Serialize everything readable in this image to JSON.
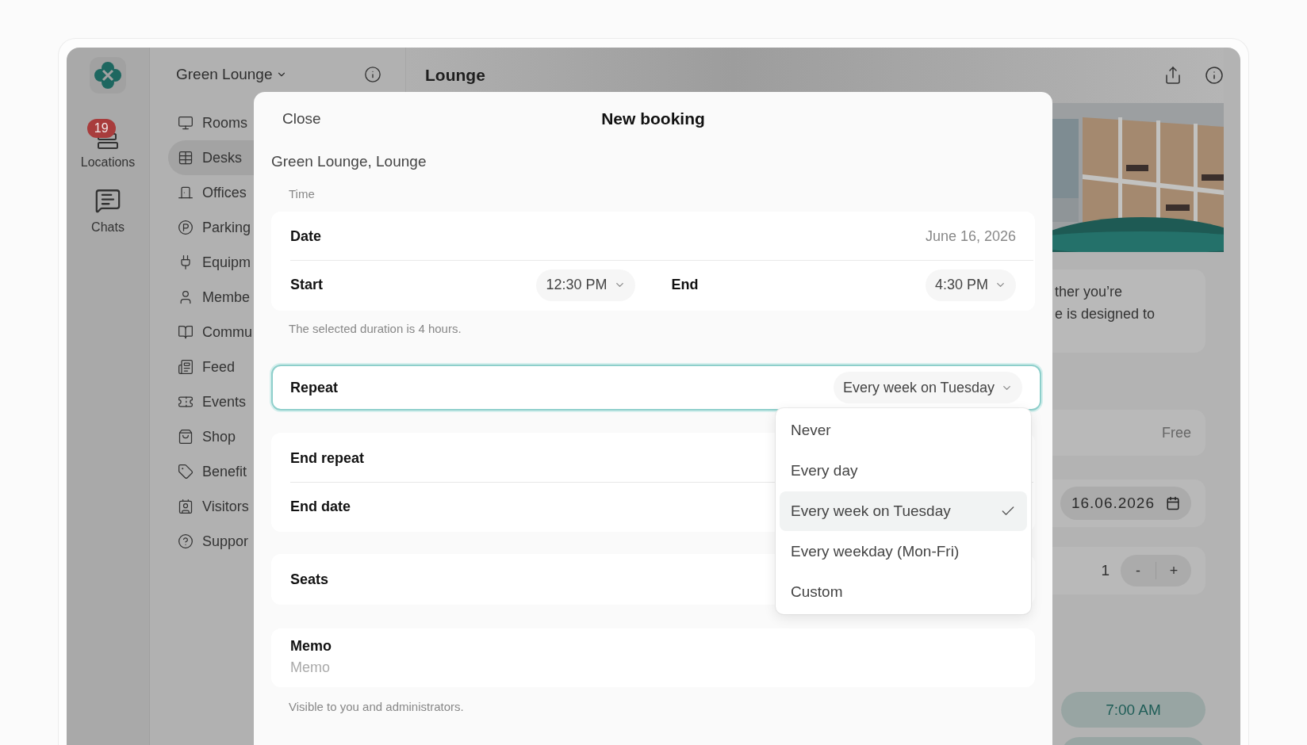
{
  "rail": {
    "items": [
      {
        "label": "Locations",
        "badge": "19"
      },
      {
        "label": "Chats"
      }
    ]
  },
  "sidebar": {
    "title": "Green Lounge",
    "items": [
      {
        "label": "Rooms",
        "selected": false
      },
      {
        "label": "Desks",
        "selected": true
      },
      {
        "label": "Offices",
        "selected": false
      },
      {
        "label": "Parking",
        "selected": false
      },
      {
        "label": "Equipm",
        "selected": false
      },
      {
        "label": "Membe",
        "selected": false
      },
      {
        "label": "Commu",
        "selected": false
      },
      {
        "label": "Feed",
        "selected": false
      },
      {
        "label": "Events",
        "selected": false
      },
      {
        "label": "Shop",
        "selected": false
      },
      {
        "label": "Benefit",
        "selected": false
      },
      {
        "label": "Visitors",
        "selected": false
      },
      {
        "label": "Suppor",
        "selected": false
      }
    ]
  },
  "main": {
    "title": "Lounge",
    "description_lines": [
      "ther you’re",
      "e is designed to"
    ],
    "price": "Free",
    "date": "16.06.2026",
    "seats": "1",
    "stepper": [
      "-",
      "+"
    ],
    "times": [
      "7:00 AM"
    ]
  },
  "modal": {
    "close": "Close",
    "title": "New booking",
    "location": "Green Lounge, Lounge",
    "time_section": "Time",
    "date": {
      "label": "Date",
      "value": "June 16, 2026"
    },
    "start": {
      "label": "Start",
      "value": "12:30 PM"
    },
    "end": {
      "label": "End",
      "value": "4:30 PM"
    },
    "duration_note": "The selected duration is 4 hours.",
    "repeat": {
      "label": "Repeat",
      "value": "Every week on Tuesday",
      "expanded": true,
      "options": [
        {
          "label": "Never",
          "selected": false
        },
        {
          "label": "Every day",
          "selected": false
        },
        {
          "label": "Every week on Tuesday",
          "selected": true
        },
        {
          "label": "Every weekday (Mon-Fri)",
          "selected": false
        },
        {
          "label": "Custom",
          "selected": false
        }
      ]
    },
    "end_repeat": {
      "label": "End repeat"
    },
    "end_date": {
      "label": "End date"
    },
    "seats": {
      "label": "Seats"
    },
    "memo": {
      "label": "Memo",
      "placeholder": "Memo"
    },
    "memo_note": "Visible to you and administrators."
  }
}
